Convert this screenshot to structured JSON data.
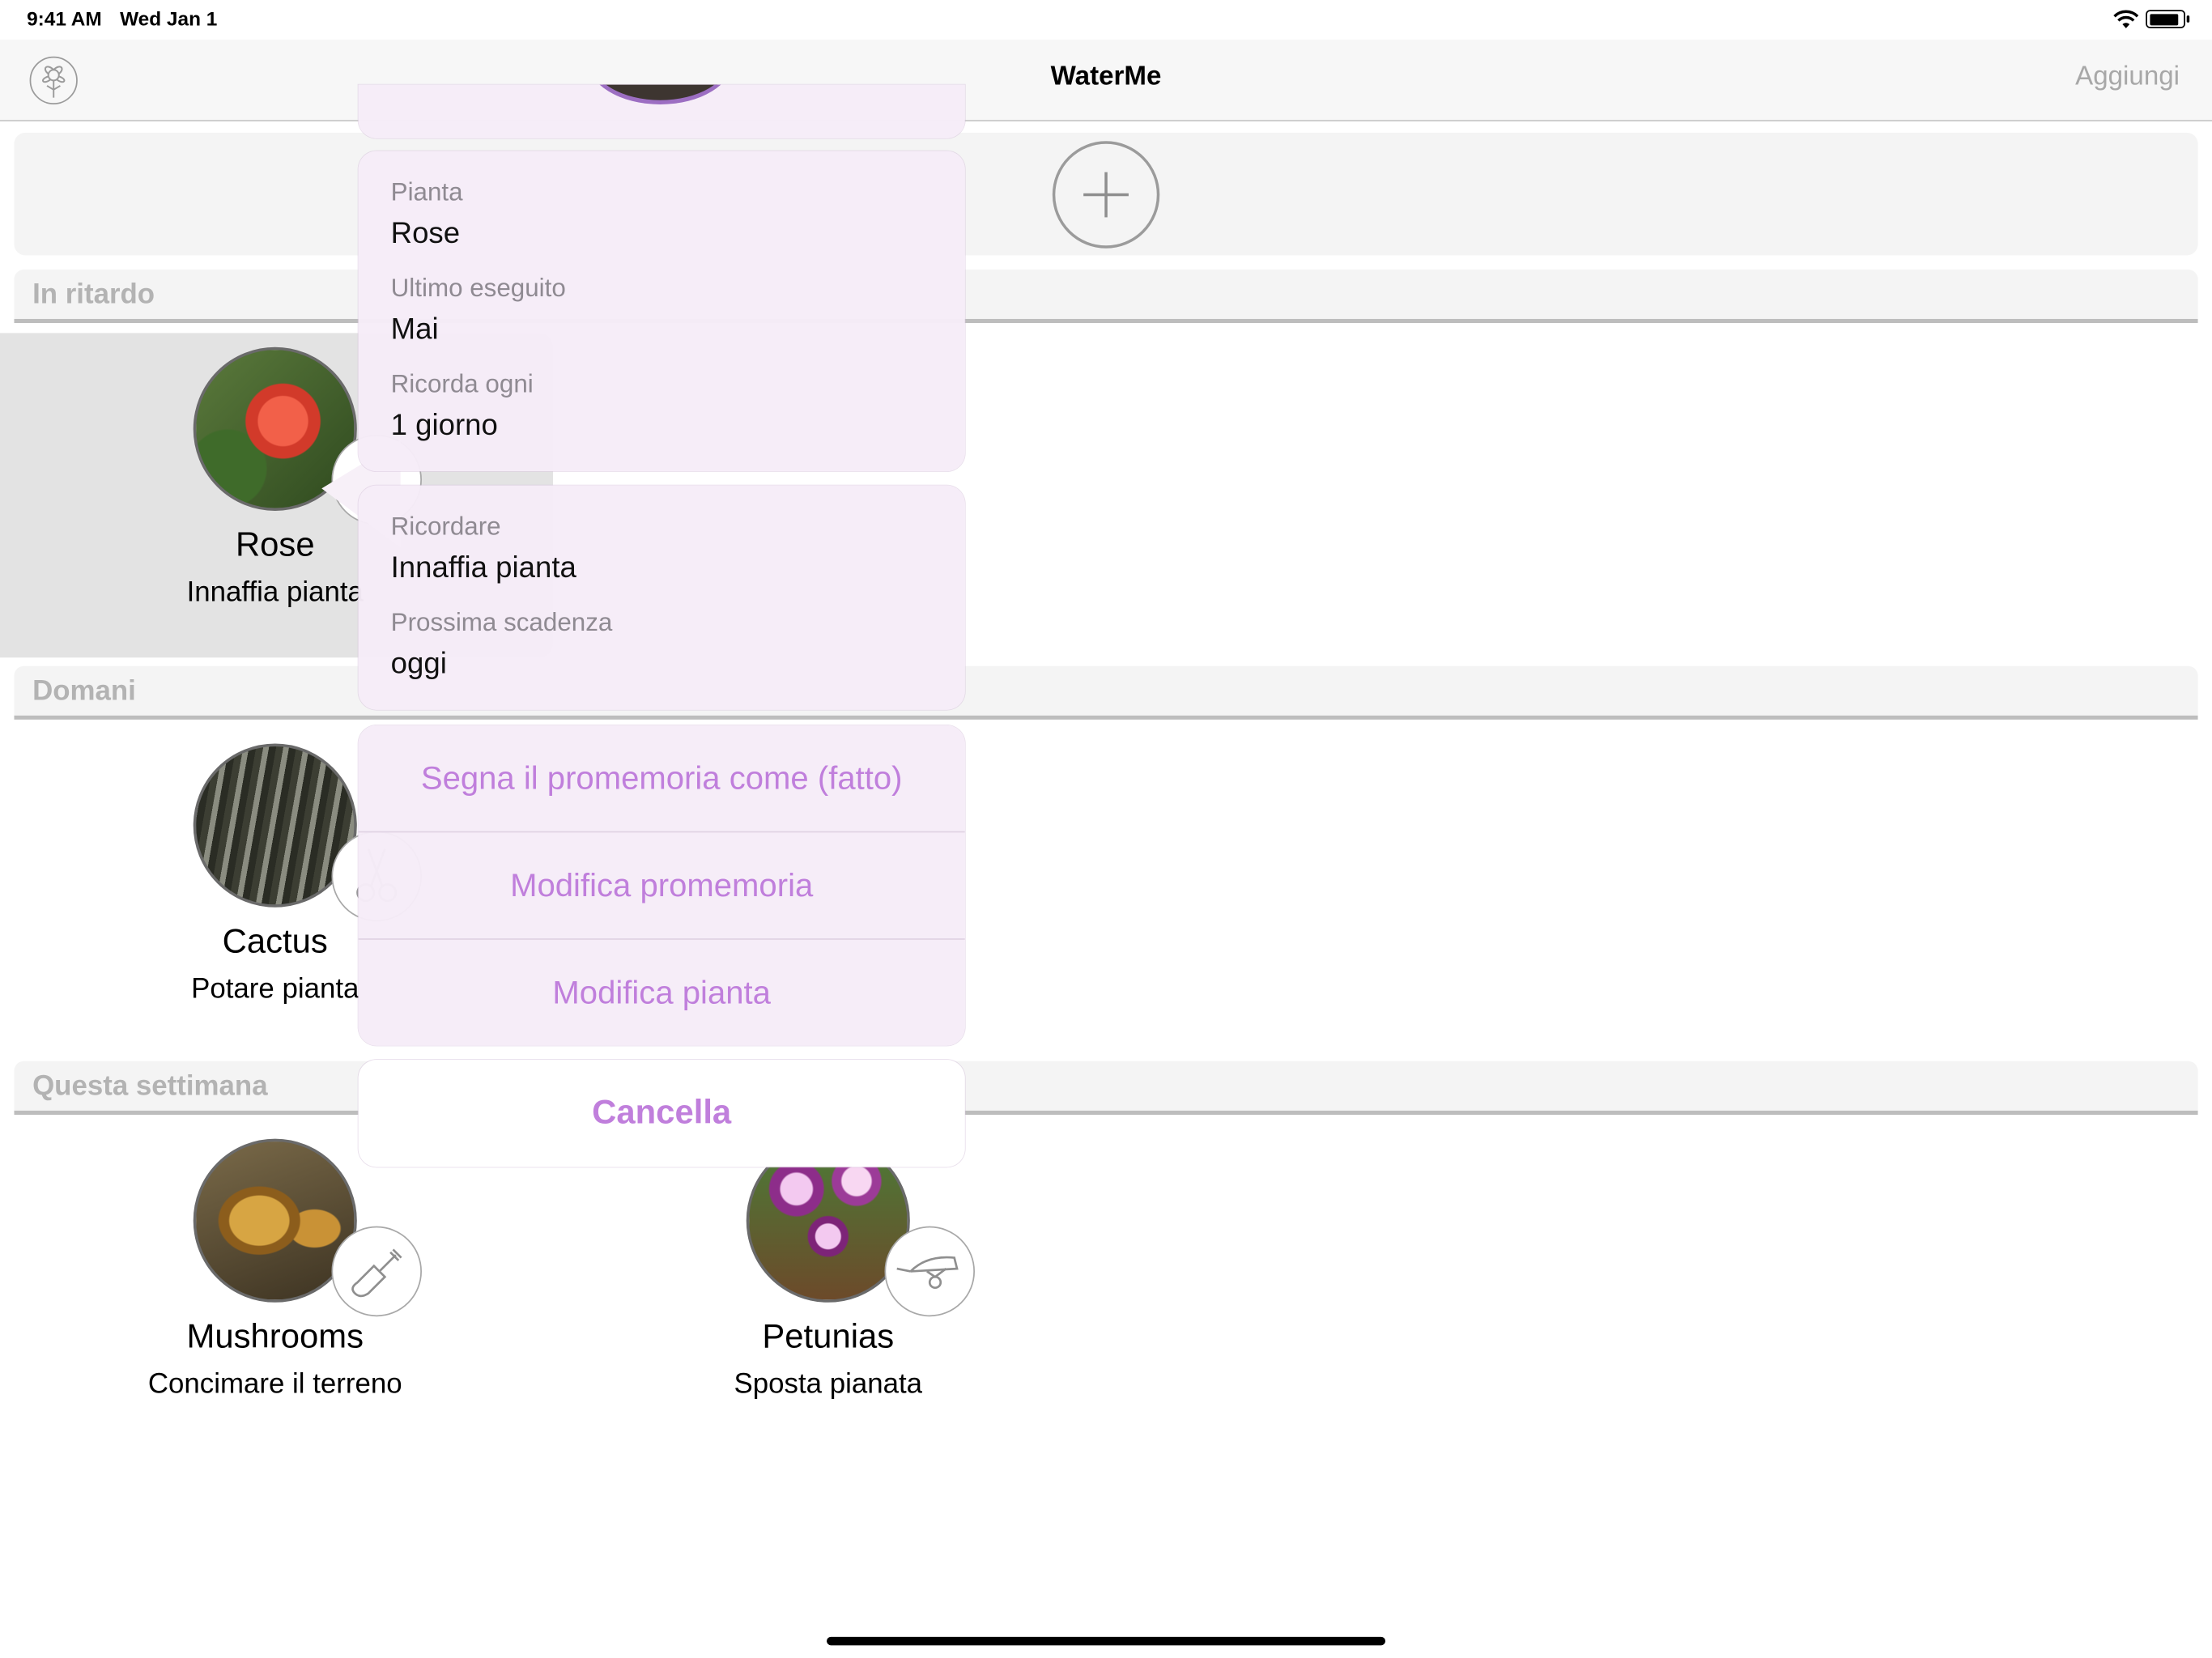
{
  "status_bar": {
    "time": "9:41 AM",
    "date": "Wed Jan 1",
    "battery_level": 0.95
  },
  "nav": {
    "title": "WaterMe",
    "add_label": "Aggiungi",
    "settings_icon": "settings-flower-icon"
  },
  "sections": {
    "overdue": "In ritardo",
    "tomorrow": "Domani",
    "this_week": "Questa settimana"
  },
  "plants": {
    "rose": {
      "name": "Rose",
      "task": "Innaffia pianta",
      "badge_icon": "watering-can-icon"
    },
    "cactus": {
      "name": "Cactus",
      "task": "Potare pianta",
      "badge_icon": "scissors-icon"
    },
    "mushrooms": {
      "name": "Mushrooms",
      "task": "Concimare il terreno",
      "badge_icon": "trowel-icon"
    },
    "petunias": {
      "name": "Petunias",
      "task": "Sposta pianata",
      "badge_icon": "wheelbarrow-icon"
    }
  },
  "popover": {
    "plant_label": "Pianta",
    "plant_value": "Rose",
    "last_done_label": "Ultimo eseguito",
    "last_done_value": "Mai",
    "remind_every_label": "Ricorda ogni",
    "remind_every_value": "1 giorno",
    "remind_label": "Ricordare",
    "remind_value": "Innaffia pianta",
    "next_due_label": "Prossima scadenza",
    "next_due_value": "oggi",
    "actions": {
      "mark_done": "Segna il promemoria come (fatto)",
      "edit_reminder": "Modifica promemoria",
      "edit_plant": "Modifica pianta"
    },
    "cancel": "Cancella"
  },
  "colors": {
    "accent": "#c07fdc",
    "section_text": "#b3b3b3",
    "nav_add": "#a8a8a8"
  }
}
